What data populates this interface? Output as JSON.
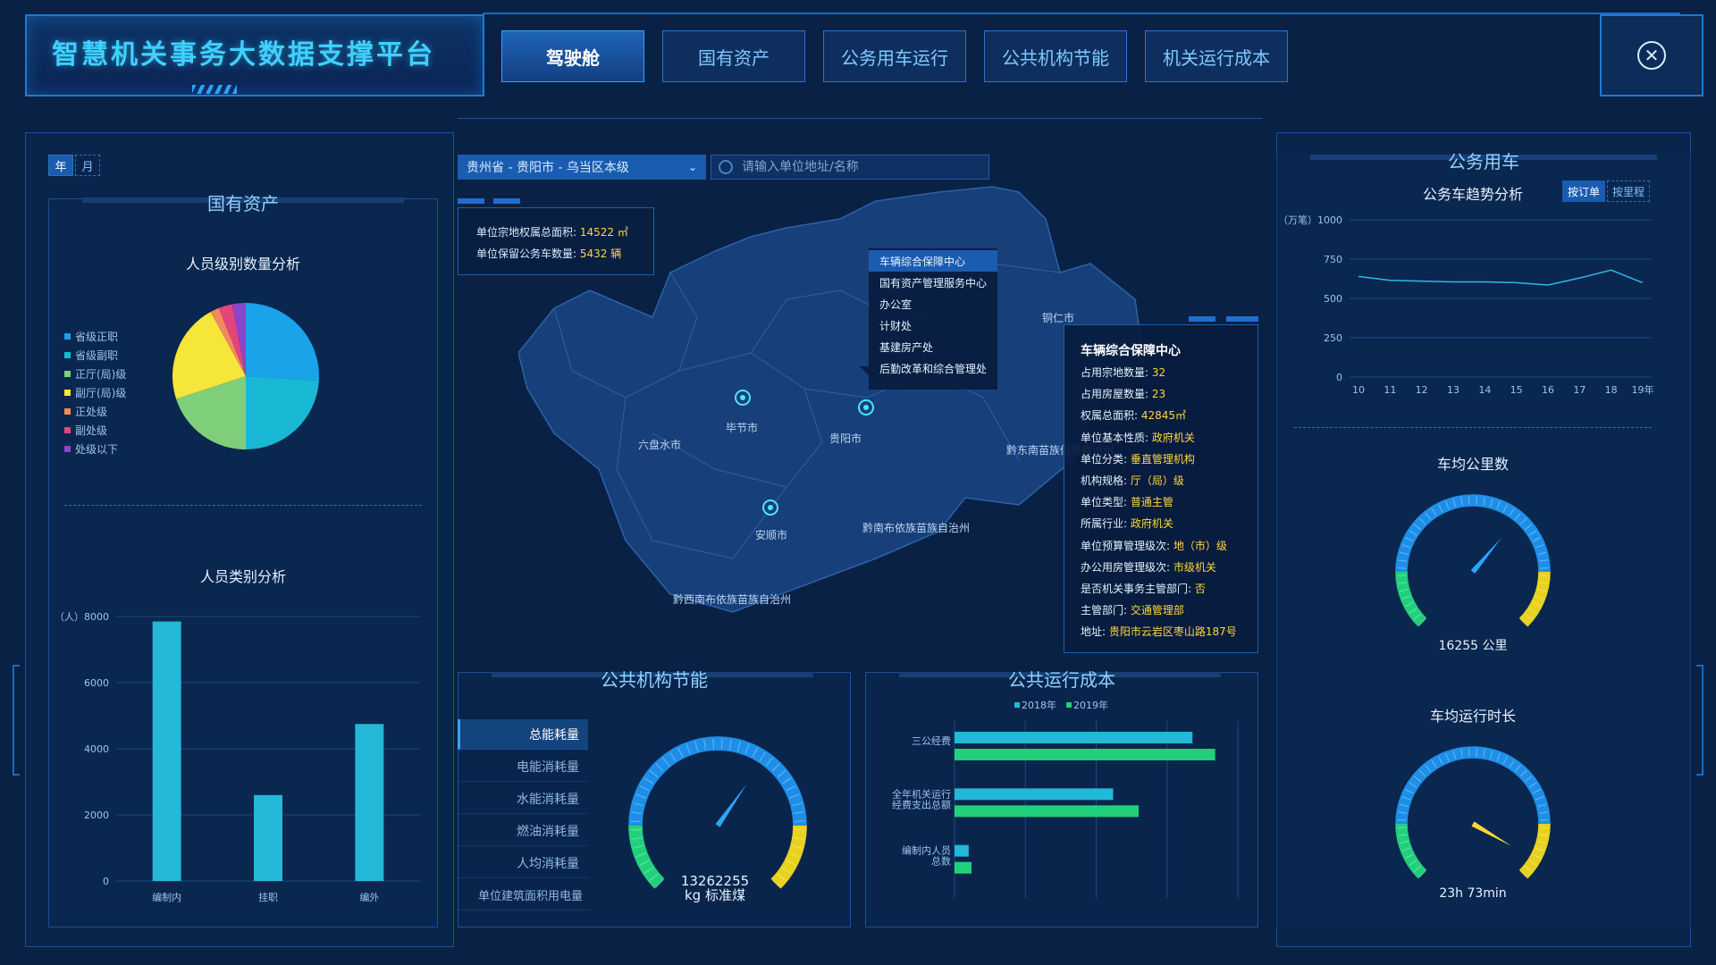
{
  "header": {
    "title": "智慧机关事务大数据支撑平台",
    "tabs": [
      {
        "label": "驾驶舱",
        "active": true
      },
      {
        "label": "国有资产",
        "active": false
      },
      {
        "label": "公务用车运行",
        "active": false
      },
      {
        "label": "公共机构节能",
        "active": false
      },
      {
        "label": "机关运行成本",
        "active": false
      }
    ],
    "close_icon": "close-icon"
  },
  "left": {
    "period": {
      "year": "年",
      "month": "月"
    },
    "title": "国有资产",
    "pie_title": "人员级别数量分析",
    "pie_legend": [
      {
        "label": "省级正职",
        "color": "#1aa3e8"
      },
      {
        "label": "省级副职",
        "color": "#18b8d4"
      },
      {
        "label": "正厅(局)级",
        "color": "#7fcf7a"
      },
      {
        "label": "副厅(局)级",
        "color": "#f7e63a"
      },
      {
        "label": "正处级",
        "color": "#f08a5a"
      },
      {
        "label": "副处级",
        "color": "#e2457a"
      },
      {
        "label": "处级以下",
        "color": "#8e44c8"
      }
    ],
    "bar_title": "人员类别分析"
  },
  "center": {
    "region_select": "贵州省 - 贵阳市 - 乌当区本级",
    "search_placeholder": "请输入单位地址/名称",
    "info": {
      "area_label": "单位宗地权属总面积:",
      "area_value": "14522 ㎡",
      "cars_label": "单位保留公务车数量:",
      "cars_value": "5432 辆"
    },
    "map_labels": {
      "tongren": "铜仁市",
      "bijie": "毕节市",
      "guiyang": "贵阳市",
      "liupanshui": "六盘水市",
      "qiandongnan": "黔东南苗族侗族自治州",
      "anshun": "安顺市",
      "qiannan": "黔南布依族苗族自治州",
      "qianxinan": "黔西南布依族苗族自治州",
      "hidden": "市"
    },
    "menu": [
      "车辆综合保障中心",
      "国有资产管理服务中心",
      "办公室",
      "计财处",
      "基建房产处",
      "后勤改革和综合管理处"
    ],
    "detail": {
      "title": "车辆综合保障中心",
      "rows": [
        {
          "k": "占用宗地数量:",
          "v": "32"
        },
        {
          "k": "占用房屋数量:",
          "v": "23"
        },
        {
          "k": "权属总面积:",
          "v": "42845㎡"
        },
        {
          "k": "单位基本性质:",
          "v": "政府机关"
        },
        {
          "k": "单位分类:",
          "v": "垂直管理机构"
        },
        {
          "k": "机构规格:",
          "v": "厅（局）级"
        },
        {
          "k": "单位类型:",
          "v": "普通主管"
        },
        {
          "k": "所属行业:",
          "v": "政府机关"
        },
        {
          "k": "单位预算管理级次:",
          "v": "地（市）级"
        },
        {
          "k": "办公用房管理级次:",
          "v": "市级机关"
        },
        {
          "k": "是否机关事务主管部门:",
          "v": "否"
        },
        {
          "k": "主管部门:",
          "v": "交通管理部"
        },
        {
          "k": "地址:",
          "v": "贵阳市云岩区枣山路187号"
        }
      ]
    },
    "energy": {
      "title": "公共机构节能",
      "items": [
        "总能耗量",
        "电能消耗量",
        "水能消耗量",
        "燃油消耗量",
        "人均消耗量",
        "单位建筑面积用电量"
      ],
      "gauge_value": "13262255",
      "gauge_unit": "kg 标准煤"
    },
    "cost": {
      "title": "公共运行成本"
    }
  },
  "right": {
    "title": "公务用车",
    "trend_title": "公务车趋势分析",
    "mode_order": "按订单",
    "mode_route": "按里程",
    "km_title": "车均公里数",
    "km_value": "16255 公里",
    "time_title": "车均运行时长",
    "time_value": "23h 73min"
  },
  "chart_data": [
    {
      "type": "pie",
      "title": "人员级别数量分析",
      "labels": [
        "省级正职",
        "省级副职",
        "正厅(局)级",
        "副厅(局)级",
        "正处级",
        "副处级",
        "处级以下"
      ],
      "values": [
        26,
        24,
        20,
        22,
        2,
        3,
        3
      ]
    },
    {
      "type": "bar",
      "title": "人员类别分析",
      "ylabel": "（人）",
      "categories": [
        "编制内",
        "挂职",
        "编外"
      ],
      "values": [
        7850,
        2600,
        4750
      ],
      "ylim": [
        0,
        8000
      ],
      "yticks": [
        0,
        2000,
        4000,
        6000,
        8000
      ]
    },
    {
      "type": "line",
      "title": "公务车趋势分析",
      "ylabel": "（万笔）",
      "x": [
        "10",
        "11",
        "12",
        "13",
        "14",
        "15",
        "16",
        "17",
        "18",
        "19年"
      ],
      "values": [
        640,
        615,
        610,
        605,
        605,
        600,
        585,
        630,
        680,
        600
      ],
      "ylim": [
        0,
        1000
      ],
      "yticks": [
        0,
        250,
        500,
        750,
        1000
      ]
    },
    {
      "type": "bar",
      "title": "公共运行成本",
      "orientation": "horizontal",
      "categories": [
        "三公经费",
        "全年机关运行经费支出总额",
        "编制内人员总数"
      ],
      "category_display": [
        [
          "三公经费"
        ],
        [
          "全年机关运行",
          "经费支出总额"
        ],
        [
          "编制内人员",
          "总数"
        ]
      ],
      "series": [
        {
          "name": "2018年",
          "color": "#23b7d8",
          "values": [
            84,
            56,
            5
          ]
        },
        {
          "name": "2019年",
          "color": "#22d07c",
          "values": [
            92,
            65,
            6
          ]
        }
      ],
      "xlim": [
        0,
        100
      ]
    }
  ],
  "colors": {
    "accent": "#3fd0ff",
    "bar": "#23b7d8",
    "gauge_blue": "#1e8fe8",
    "gauge_green": "#22d07c",
    "gauge_yellow": "#e8d21e",
    "highlight": "#ffd83a"
  }
}
